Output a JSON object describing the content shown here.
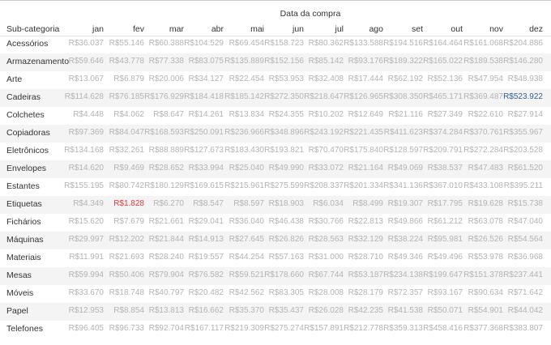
{
  "chart_data": {
    "type": "table",
    "title": "Data da compra",
    "row_dimension": "Sub-categoria",
    "columns": [
      "jan",
      "fev",
      "mar",
      "abr",
      "mai",
      "jun",
      "jul",
      "ago",
      "set",
      "out",
      "nov",
      "dez"
    ],
    "rows": [
      {
        "label": "Acessórios",
        "values": [
          "R$36.037",
          "R$55.146",
          "R$60.388",
          "R$104.529",
          "R$69.454",
          "R$158.723",
          "R$80.362",
          "R$133.588",
          "R$194.516",
          "R$164.464",
          "R$161.068",
          "R$204.886"
        ]
      },
      {
        "label": "Armazenamento",
        "values": [
          "R$59.646",
          "R$43.778",
          "R$77.338",
          "R$83.075",
          "R$135.889",
          "R$152.156",
          "R$85.142",
          "R$93.176",
          "R$189.322",
          "R$165.022",
          "R$189.538",
          "R$146.280"
        ]
      },
      {
        "label": "Arte",
        "values": [
          "R$13.067",
          "R$6.879",
          "R$20.006",
          "R$34.127",
          "R$22.454",
          "R$53.953",
          "R$32.408",
          "R$17.444",
          "R$62.192",
          "R$52.136",
          "R$47.954",
          "R$48.938"
        ]
      },
      {
        "label": "Cadeiras",
        "values": [
          "R$114.628",
          "R$76.185",
          "R$176.929",
          "R$184.418",
          "R$185.142",
          "R$272.350",
          "R$218.647",
          "R$126.965",
          "R$308.350",
          "R$465.171",
          "R$369.487",
          "R$523.922"
        ]
      },
      {
        "label": "Colchetes",
        "values": [
          "R$4.448",
          "R$4.062",
          "R$8.647",
          "R$14.261",
          "R$13.834",
          "R$24.355",
          "R$10.202",
          "R$12.649",
          "R$21.116",
          "R$27.349",
          "R$22.610",
          "R$27.914"
        ]
      },
      {
        "label": "Copiadoras",
        "values": [
          "R$97.369",
          "R$84.047",
          "R$168.593",
          "R$250.091",
          "R$236.966",
          "R$348.896",
          "R$243.192",
          "R$221.435",
          "R$411.623",
          "R$374.284",
          "R$370.761",
          "R$355.967"
        ]
      },
      {
        "label": "Eletrônicos",
        "values": [
          "R$134.168",
          "R$32.261",
          "R$88.889",
          "R$127.673",
          "R$183.430",
          "R$193.821",
          "R$70.470",
          "R$175.840",
          "R$128.597",
          "R$209.791",
          "R$272.284",
          "R$203.528"
        ]
      },
      {
        "label": "Envelopes",
        "values": [
          "R$14.620",
          "R$9.469",
          "R$28.652",
          "R$33.994",
          "R$25.040",
          "R$49.990",
          "R$33.072",
          "R$21.164",
          "R$49.069",
          "R$38.537",
          "R$47.483",
          "R$61.520"
        ]
      },
      {
        "label": "Estantes",
        "values": [
          "R$155.195",
          "R$80.742",
          "R$180.129",
          "R$169.615",
          "R$215.961",
          "R$275.599",
          "R$208.337",
          "R$201.334",
          "R$341.136",
          "R$367.010",
          "R$433.108",
          "R$395.211"
        ]
      },
      {
        "label": "Etiquetas",
        "values": [
          "R$4.349",
          "R$1.828",
          "R$6.270",
          "R$8.547",
          "R$8.597",
          "R$18.903",
          "R$6.034",
          "R$8.499",
          "R$19.307",
          "R$17.795",
          "R$19.628",
          "R$15.738"
        ]
      },
      {
        "label": "Fichários",
        "values": [
          "R$15.620",
          "R$7.679",
          "R$21.661",
          "R$29.041",
          "R$36.040",
          "R$46.438",
          "R$30.766",
          "R$22.813",
          "R$49.866",
          "R$61.212",
          "R$63.078",
          "R$47.040"
        ]
      },
      {
        "label": "Máquinas",
        "values": [
          "R$29.997",
          "R$12.202",
          "R$21.844",
          "R$14.913",
          "R$27.645",
          "R$26.826",
          "R$28.563",
          "R$32.129",
          "R$38.224",
          "R$95.981",
          "R$26.526",
          "R$54.564"
        ]
      },
      {
        "label": "Materiais",
        "values": [
          "R$11.991",
          "R$21.693",
          "R$28.240",
          "R$19.557",
          "R$44.254",
          "R$57.163",
          "R$31.000",
          "R$28.710",
          "R$49.346",
          "R$49.496",
          "R$53.978",
          "R$36.968"
        ]
      },
      {
        "label": "Mesas",
        "values": [
          "R$59.994",
          "R$50.406",
          "R$79.904",
          "R$76.582",
          "R$59.521",
          "R$178.660",
          "R$67.744",
          "R$53.187",
          "R$234.138",
          "R$199.647",
          "R$151.378",
          "R$237.441"
        ]
      },
      {
        "label": "Móveis",
        "values": [
          "R$33.670",
          "R$18.748",
          "R$40.797",
          "R$20.482",
          "R$42.562",
          "R$83.305",
          "R$28.008",
          "R$28.179",
          "R$72.357",
          "R$93.167",
          "R$90.634",
          "R$71.642"
        ]
      },
      {
        "label": "Papel",
        "values": [
          "R$12.953",
          "R$8.854",
          "R$13.813",
          "R$16.662",
          "R$35.370",
          "R$35.437",
          "R$26.028",
          "R$42.235",
          "R$41.538",
          "R$50.071",
          "R$54.901",
          "R$44.042"
        ]
      },
      {
        "label": "Telefones",
        "values": [
          "R$96.405",
          "R$96.733",
          "R$92.704",
          "R$167.117",
          "R$219.309",
          "R$275.274",
          "R$157.891",
          "R$212.778",
          "R$359.313",
          "R$458.416",
          "R$377.368",
          "R$383.807"
        ]
      }
    ],
    "highlights": {
      "min": {
        "row": 9,
        "col": 1,
        "color": "#e03a3a"
      },
      "max": {
        "row": 3,
        "col": 11,
        "color": "#2f5f9a"
      }
    },
    "default_value_color": "#b3b3b3",
    "banded_rows": true
  }
}
